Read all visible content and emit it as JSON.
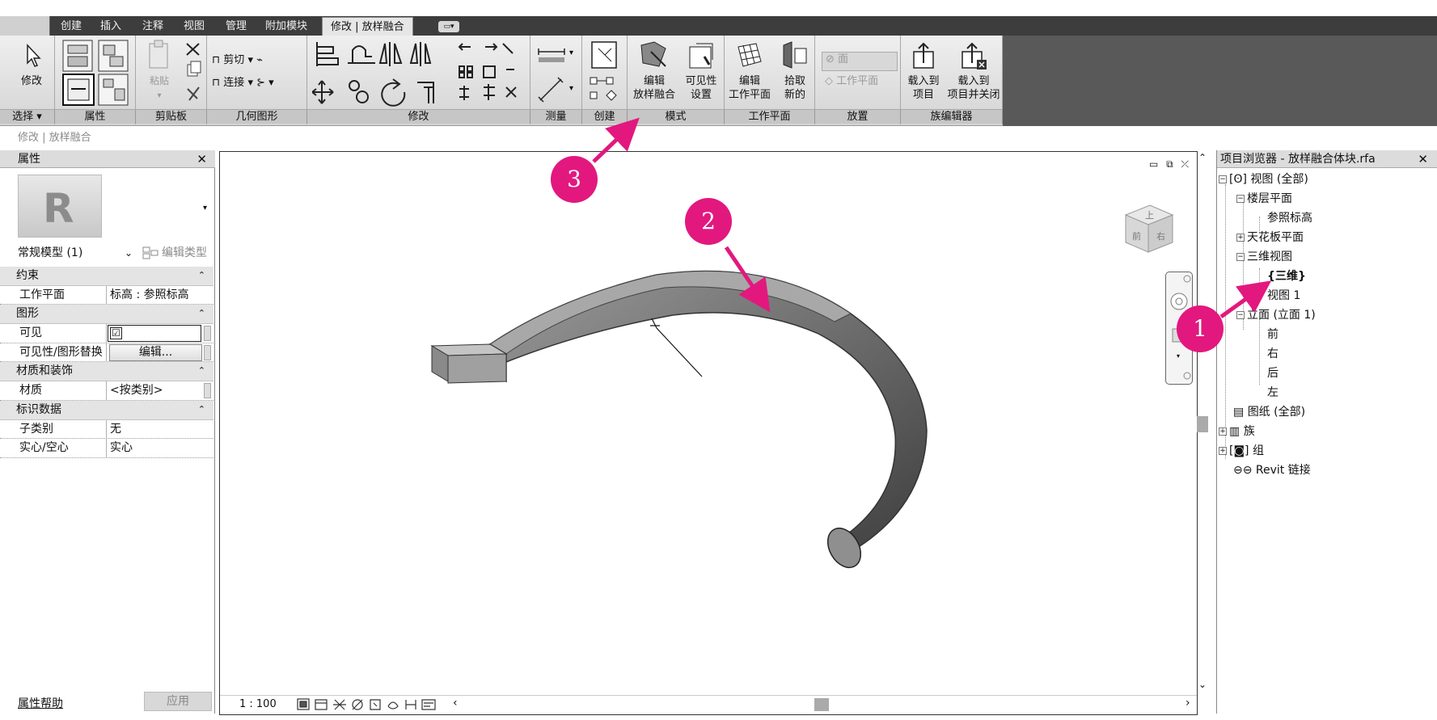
{
  "ribbon": {
    "tabs": [
      "创建",
      "插入",
      "注释",
      "视图",
      "管理",
      "附加模块",
      "修改 | 放样融合"
    ],
    "panels": {
      "select": {
        "title": "选择",
        "modify_label": "修改"
      },
      "properties": {
        "title": "属性"
      },
      "clipboard": {
        "title": "剪贴板",
        "paste_label": "粘贴"
      },
      "geometry": {
        "title": "几何图形",
        "cut_label": "剪切",
        "join_label": "连接"
      },
      "modify": {
        "title": "修改"
      },
      "measure": {
        "title": "测量"
      },
      "create": {
        "title": "创建"
      },
      "mode": {
        "title": "模式",
        "edit_sweep_blend_l1": "编辑",
        "edit_sweep_blend_l2": "放样融合",
        "visibility_l1": "可见性",
        "visibility_l2": "设置"
      },
      "workplane": {
        "title": "工作平面",
        "edit_wp_l1": "编辑",
        "edit_wp_l2": "工作平面",
        "pick_new_l1": "拾取",
        "pick_new_l2": "新的"
      },
      "placement": {
        "title": "放置",
        "face_label": "面",
        "workplane_label": "工作平面"
      },
      "family_editor": {
        "title": "族编辑器",
        "load_l1": "载入到",
        "load_l2": "项目",
        "load_close_l1": "载入到",
        "load_close_l2": "项目并关闭"
      }
    }
  },
  "breadcrumb": "修改 | 放样融合",
  "properties": {
    "title": "属性",
    "type_name": "常规模型 (1)",
    "edit_type": "编辑类型",
    "sections": [
      {
        "name": "约束",
        "rows": [
          {
            "key": "工作平面",
            "value": "标高 : 参照标高"
          }
        ]
      },
      {
        "name": "图形",
        "rows": [
          {
            "key": "可见",
            "value": "☑"
          },
          {
            "key": "可见性/图形替换",
            "value": "编辑..."
          }
        ]
      },
      {
        "name": "材质和装饰",
        "rows": [
          {
            "key": "材质",
            "value": "<按类别>"
          }
        ]
      },
      {
        "name": "标识数据",
        "rows": [
          {
            "key": "子类别",
            "value": "无"
          },
          {
            "key": "实心/空心",
            "value": "实心"
          }
        ]
      }
    ],
    "help_link": "属性帮助",
    "apply_button": "应用"
  },
  "viewport": {
    "scale": "1 : 100",
    "viewcube_top": "上",
    "viewcube_front": "前",
    "viewcube_right": "右"
  },
  "project_browser": {
    "title": "项目浏览器 - 放样融合体块.rfa",
    "nodes": {
      "views_all": "视图 (全部)",
      "floor_plans": "楼层平面",
      "ref_level": "参照标高",
      "ceiling_plans": "天花板平面",
      "views_3d": "三维视图",
      "view_3d_default": "{三维}",
      "view_1": "视图 1",
      "elevations": "立面 (立面 1)",
      "front": "前",
      "right": "右",
      "back": "后",
      "left": "左",
      "sheets": "图纸 (全部)",
      "families": "族",
      "groups": "组",
      "revit_links": "Revit 链接"
    }
  },
  "callouts": [
    "1",
    "2",
    "3"
  ],
  "colors": {
    "callout": "#e2187f",
    "ribbon_dark": "#3d3d3d"
  }
}
